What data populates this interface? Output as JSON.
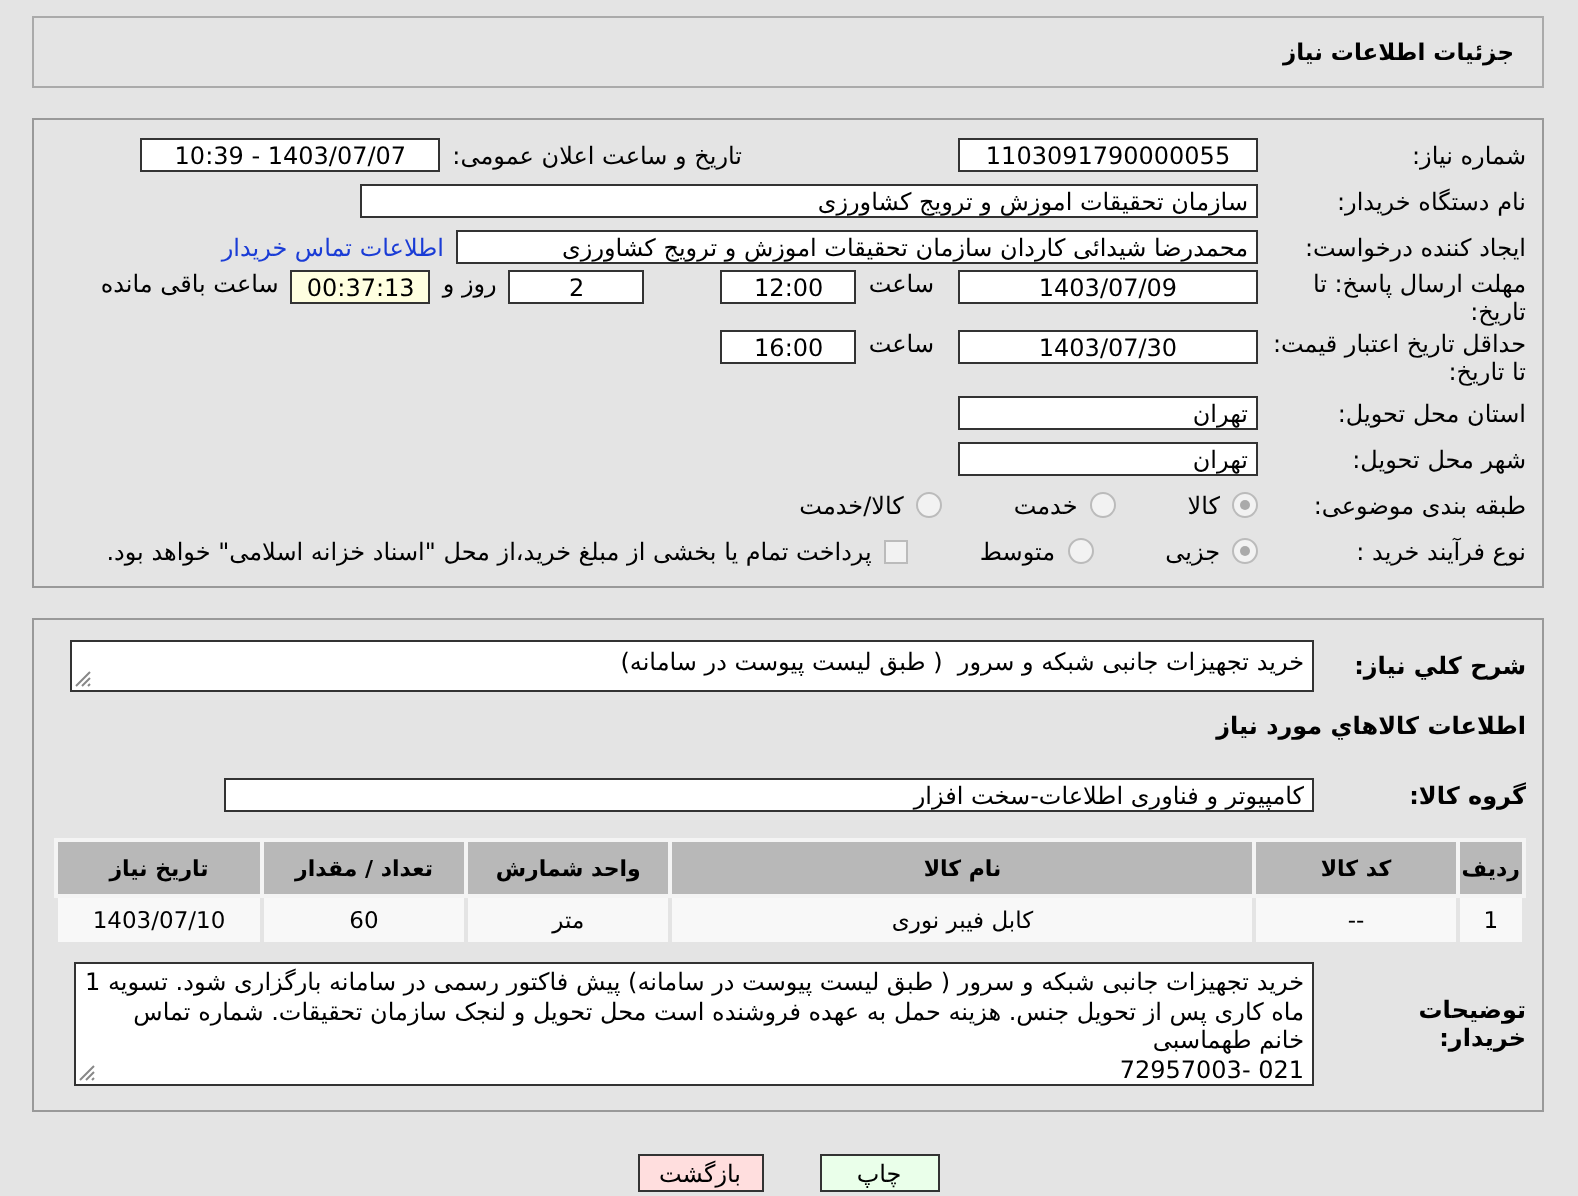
{
  "header": {
    "title": "جزئیات اطلاعات نیاز"
  },
  "need_number": {
    "label": "شماره نیاز:",
    "value": "1103091790000055"
  },
  "announce": {
    "label": "تاریخ و ساعت اعلان عمومی:",
    "value": "1403/07/07 - 10:39"
  },
  "buyer_org": {
    "label": "نام دستگاه خریدار:",
    "value": "سازمان تحقیقات  اموزش و ترویج کشاورزی"
  },
  "requester": {
    "label": "ایجاد کننده درخواست:",
    "value": "محمدرضا شیدائی کاردان سازمان تحقیقات  اموزش و ترویج کشاورزی",
    "link": "اطلاعات تماس خریدار"
  },
  "deadline": {
    "label": "مهلت ارسال پاسخ: تا تاریخ:",
    "date": "1403/07/09",
    "time_label": "ساعت",
    "time": "12:00",
    "days": "2",
    "days_label": "روز و",
    "remaining": "00:37:13",
    "remaining_label": "ساعت باقی مانده"
  },
  "validity": {
    "label": "حداقل تاریخ اعتبار قیمت: تا تاریخ:",
    "date": "1403/07/30",
    "time_label": "ساعت",
    "time": "16:00"
  },
  "province": {
    "label": "استان محل تحویل:",
    "value": "تهران"
  },
  "city": {
    "label": "شهر محل تحویل:",
    "value": "تهران"
  },
  "category": {
    "label": "طبقه بندی موضوعی:",
    "options": [
      {
        "label": "کالا",
        "selected": true
      },
      {
        "label": "خدمت",
        "selected": false
      },
      {
        "label": "کالا/خدمت",
        "selected": false
      }
    ]
  },
  "process": {
    "label": "نوع فرآیند خرید :",
    "options": [
      {
        "label": "جزیی",
        "selected": true
      },
      {
        "label": "متوسط",
        "selected": false
      }
    ],
    "payment": {
      "checked": false,
      "text": "پرداخت تمام یا بخشی از مبلغ خرید،از محل \"اسناد خزانه اسلامی\" خواهد بود."
    }
  },
  "description": {
    "label": "شرح کلي نياز:",
    "value": "خرید تجهیزات جانبی شبکه و سرور  ( طبق لیست پیوست در سامانه)"
  },
  "goods_heading": "اطلاعات کالاهاي مورد نياز",
  "goods_group": {
    "label": "گروه کالا:",
    "value": "کامپیوتر و فناوری اطلاعات-سخت افزار"
  },
  "table": {
    "columns": [
      "ردیف",
      "کد کالا",
      "نام کالا",
      "واحد شمارش",
      "تعداد / مقدار",
      "تاریخ نیاز"
    ],
    "rows": [
      [
        "1",
        "--",
        "کابل فیبر نوری",
        "متر",
        "60",
        "1403/07/10"
      ]
    ]
  },
  "buyer_notes": {
    "label": "توضیحات خریدار:",
    "value": "خرید تجهیزات جانبی شبکه و سرور ( طبق لیست پیوست در سامانه) پیش فاکتور رسمی در سامانه بارگزاری شود. تسویه 1 ماه کاری پس از تحویل جنس. هزینه حمل به عهده فروشنده است محل تحویل و لنجک سازمان تحقیقات. شماره تماس خانم طهماسبی\n021 -72957003"
  },
  "buttons": [
    {
      "label": "چاپ",
      "kind": "print"
    },
    {
      "label": "بازگشت",
      "kind": "back"
    }
  ]
}
